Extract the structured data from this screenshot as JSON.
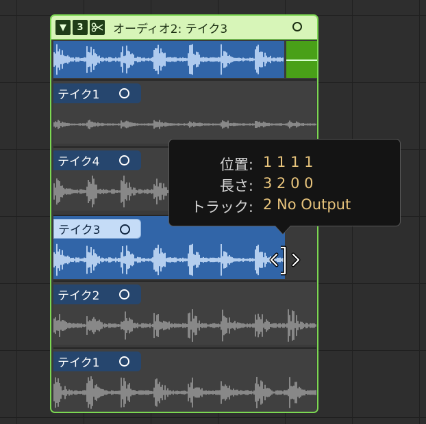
{
  "folder": {
    "collapse_glyph": "▼",
    "take_count": "3",
    "scissors_icon": "scissors-icon",
    "title": "オーディオ2: テイク3",
    "accent_color": "#7cd852"
  },
  "lanes": [
    {
      "label": "テイク1",
      "active": false
    },
    {
      "label": "テイク4",
      "active": false
    },
    {
      "label": "テイク3",
      "active": true
    },
    {
      "label": "テイク2",
      "active": false
    },
    {
      "label": "テイク1",
      "active": false
    }
  ],
  "tooltip": {
    "position_label": "位置:",
    "position_value": "1 1 1 1",
    "length_label": "長さ:",
    "length_value": "3 2 0 0",
    "track_label": "トラック:",
    "track_value": "2  No Output"
  },
  "cursor": "resize-cursor-icon"
}
